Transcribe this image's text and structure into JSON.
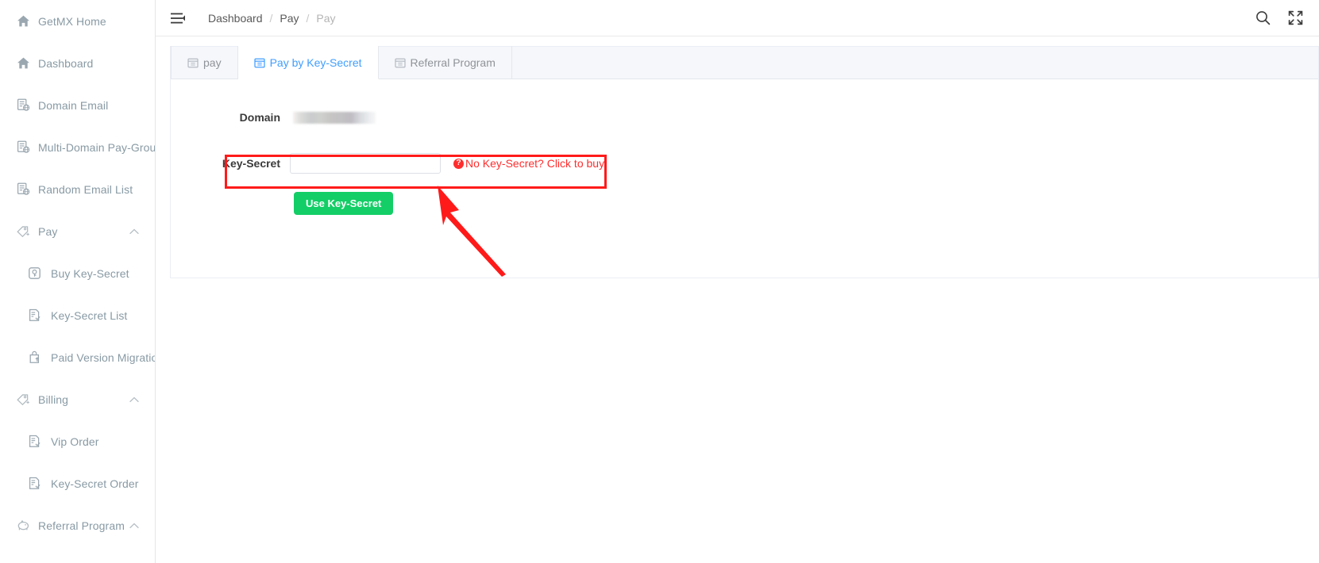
{
  "sidebar": {
    "items": [
      {
        "label": "GetMX Home",
        "icon": "home-icon",
        "level": 0,
        "caret": false
      },
      {
        "label": "Dashboard",
        "icon": "home-icon",
        "level": 0,
        "caret": false
      },
      {
        "label": "Domain Email",
        "icon": "domain-mail-icon",
        "level": 0,
        "caret": false
      },
      {
        "label": "Multi-Domain Pay-Group",
        "icon": "domain-mail-icon",
        "level": 0,
        "caret": false
      },
      {
        "label": "Random Email List",
        "icon": "domain-mail-icon",
        "level": 0,
        "caret": false
      },
      {
        "label": "Pay",
        "icon": "pay-tag-icon",
        "level": 0,
        "caret": true
      },
      {
        "label": "Buy Key-Secret",
        "icon": "key-box-icon",
        "level": 1,
        "caret": false
      },
      {
        "label": "Key-Secret List",
        "icon": "list-doc-icon",
        "level": 1,
        "caret": false
      },
      {
        "label": "Paid Version Migration",
        "icon": "upload-bag-icon",
        "level": 1,
        "caret": false
      },
      {
        "label": "Billing",
        "icon": "pay-tag-icon",
        "level": 0,
        "caret": true
      },
      {
        "label": "Vip Order",
        "icon": "list-doc-icon",
        "level": 1,
        "caret": false
      },
      {
        "label": "Key-Secret Order",
        "icon": "list-doc-icon",
        "level": 1,
        "caret": false
      },
      {
        "label": "Referral Program",
        "icon": "piggy-icon",
        "level": 0,
        "caret": true
      }
    ]
  },
  "topbar": {
    "menu_icon": "hamburger-collapse-icon",
    "breadcrumb": [
      "Dashboard",
      "Pay",
      "Pay"
    ],
    "separator": "/",
    "search_icon": "search-icon",
    "fullscreen_icon": "fullscreen-icon"
  },
  "tabs": [
    {
      "label": "pay",
      "icon": "calendar-icon",
      "active": false
    },
    {
      "label": "Pay by Key-Secret",
      "icon": "calendar-icon",
      "active": true
    },
    {
      "label": "Referral Program",
      "icon": "calendar-icon",
      "active": false
    }
  ],
  "form": {
    "domain_label": "Domain",
    "domain_value": "",
    "key_secret_label": "Key-Secret",
    "key_secret_value": "",
    "key_secret_placeholder": "",
    "buy_link_badge": "?",
    "buy_link_text": "No Key-Secret? Click to buy",
    "submit_label": "Use Key-Secret"
  },
  "colors": {
    "accent_blue": "#409eff",
    "submit_green": "#13ce66",
    "annotation_red": "#ff1a1a",
    "link_red": "#ff2d2d",
    "sidebar_text": "#889aa4",
    "tabbar_bg": "#f5f7fa"
  }
}
